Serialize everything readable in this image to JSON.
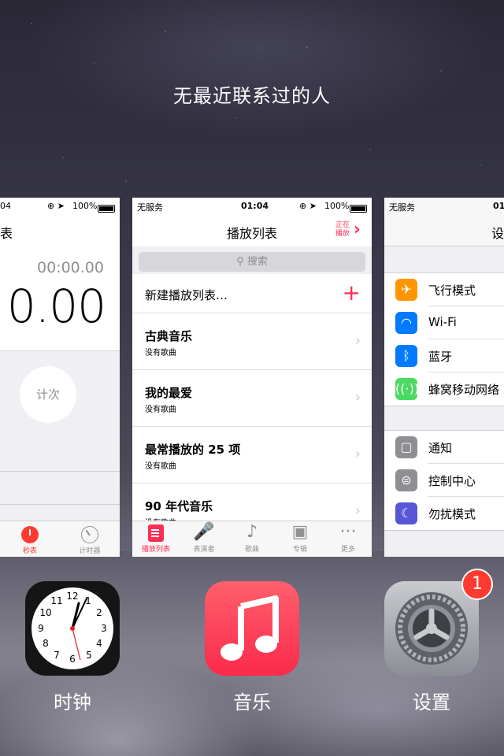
{
  "header": {
    "no_recent_contacts": "无最近联系过的人"
  },
  "clock_card": {
    "status_time": "04",
    "status_battery": "100%",
    "title": "表",
    "lap_time": "00:00.00",
    "main_time": "0.00",
    "lap_button": "计次",
    "tabs": [
      {
        "label": "秒表",
        "icon": "stopwatch-icon"
      },
      {
        "label": "计时器",
        "icon": "timer-icon"
      }
    ]
  },
  "music_card": {
    "status_carrier": "无服务",
    "status_time": "01:04",
    "status_battery": "100%",
    "title": "播放列表",
    "now_playing": "正在\n播放",
    "search_placeholder": "搜索",
    "new_playlist": "新建播放列表…",
    "playlists": [
      {
        "name": "古典音乐",
        "sub": "没有歌曲"
      },
      {
        "name": "我的最爱",
        "sub": "没有歌曲"
      },
      {
        "name": "最常播放的 25 项",
        "sub": "没有歌曲"
      },
      {
        "name": "90 年代音乐",
        "sub": "没有歌曲"
      }
    ],
    "tabs": [
      {
        "label": "播放列表",
        "icon": "playlist-icon"
      },
      {
        "label": "表演者",
        "icon": "artist-icon"
      },
      {
        "label": "歌曲",
        "icon": "music-note-icon"
      },
      {
        "label": "专辑",
        "icon": "album-icon"
      },
      {
        "label": "更多",
        "icon": "more-icon"
      }
    ]
  },
  "settings_card": {
    "status_carrier": "无服务",
    "status_time": "01:",
    "title": "设",
    "group1": [
      {
        "label": "飞行模式",
        "icon": "airplane-icon",
        "color": "#ff9500"
      },
      {
        "label": "Wi-Fi",
        "icon": "wifi-icon",
        "color": "#007aff"
      },
      {
        "label": "蓝牙",
        "icon": "bluetooth-icon",
        "color": "#007aff"
      },
      {
        "label": "蜂窝移动网络",
        "icon": "cellular-icon",
        "color": "#4cd964"
      }
    ],
    "group2": [
      {
        "label": "通知",
        "icon": "notification-icon",
        "color": "#8e8e93"
      },
      {
        "label": "控制中心",
        "icon": "control-center-icon",
        "color": "#8e8e93"
      },
      {
        "label": "勿扰模式",
        "icon": "moon-icon",
        "color": "#5856d6"
      }
    ]
  },
  "dock": {
    "clock_name": "时钟",
    "music_name": "音乐",
    "settings_name": "设置",
    "settings_badge": "1"
  }
}
